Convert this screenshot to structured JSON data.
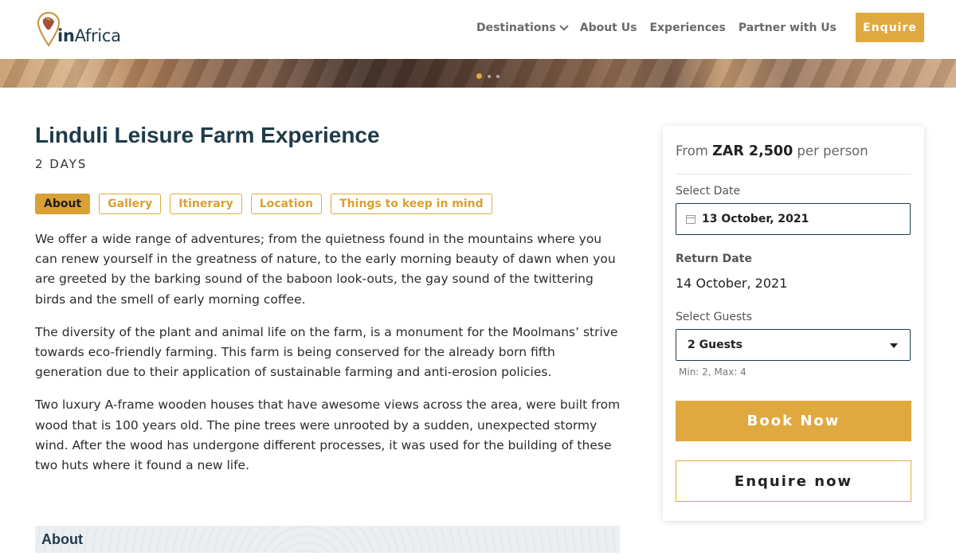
{
  "header": {
    "logo_text_bold": "in",
    "logo_text": "Africa",
    "nav": [
      {
        "label": "Destinations"
      },
      {
        "label": "About Us"
      },
      {
        "label": "Experiences"
      },
      {
        "label": "Partner with Us"
      }
    ],
    "enquire_label": "Enquire"
  },
  "hero": {
    "slide_count": 3,
    "active_slide": 1
  },
  "main": {
    "title": "Linduli Leisure Farm Experience",
    "duration": "2 DAYS",
    "tabs": [
      "About",
      "Gallery",
      "Itinerary",
      "Location",
      "Things to keep in mind"
    ],
    "active_tab": "About",
    "paragraphs": [
      "We offer a wide range of adventures;  from the quietness found in the mountains where you can renew yourself in the greatness of nature, to the early morning beauty of dawn when you are greeted by the barking sound of the baboon look-outs, the gay sound of the twittering birds and the smell of early morning coffee.",
      "The diversity of the plant and animal life on the farm, is a monument for the Moolmans’ strive towards eco-friendly farming. This farm is being conserved for the already born fifth generation due to their application of sustainable farming and anti-erosion policies.",
      "Two luxury A-frame wooden houses that have awesome views across the area, were built from wood that is 100 years old. The pine trees were unrooted by a sudden, unexpected stormy wind. After the wood has undergone different processes, it was used for the building of these two huts where it found a new life."
    ],
    "section_heading": "About"
  },
  "booking": {
    "price_prefix": "From ",
    "price_value": "ZAR 2,500",
    "price_suffix": " per person",
    "select_date_label": "Select Date",
    "select_date_value": "13 October, 2021",
    "return_date_label": "Return Date",
    "return_date_value": "14 October, 2021",
    "select_guests_label": "Select Guests",
    "select_guests_value": "2 Guests",
    "guests_hint": "Min: 2, Max: 4",
    "book_label": "Book Now",
    "enquire_label": "Enquire now"
  },
  "colors": {
    "accent": "#e0a93f",
    "navy": "#1f3a4a"
  }
}
